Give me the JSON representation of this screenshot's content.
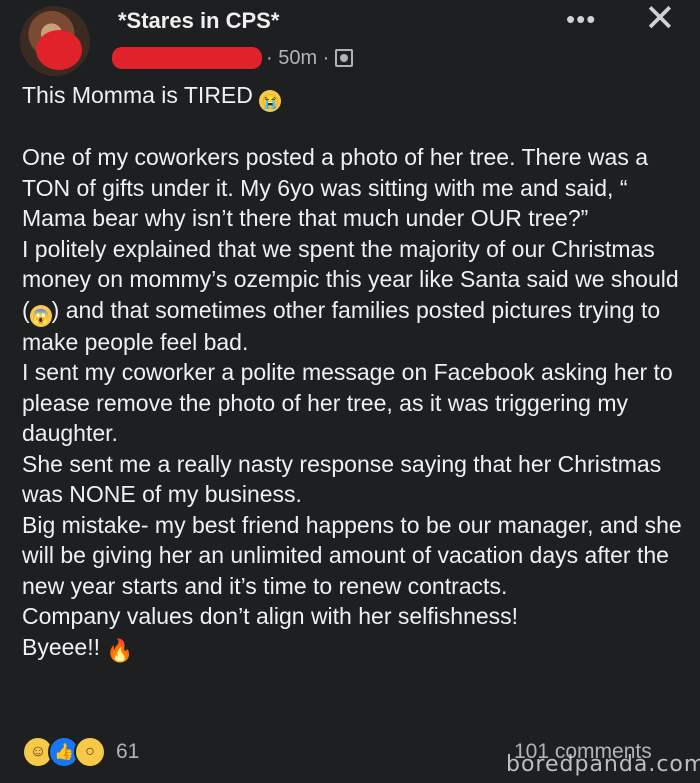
{
  "header": {
    "page_name": "*Stares in CPS*",
    "time": "· 50m ·",
    "more_icon": "more-horizontal-icon",
    "close_icon": "close-icon",
    "privacy_icon": "friends-icon"
  },
  "post": {
    "title": "This Momma is TIRED",
    "paragraphs": [
      "One of my coworkers posted a photo of her tree. There was a TON of gifts under it. My 6yo was sitting with me and said, “ Mama bear why isn’t there that much under OUR tree?”",
      "I politely explained that we spent the majority of our Christmas money on mommy’s ozempic this year like Santa said we should (",
      ") and that sometimes other families posted pictures trying to make people feel bad.",
      "I sent my coworker a polite message on Facebook asking her to please remove the photo of her tree, as it was triggering my daughter.",
      "She sent me a really nasty response saying that her Christmas was NONE of my business.",
      "Big mistake- my best friend happens to be our manager, and she will be giving her an unlimited amount of vacation days after the new year starts and it’s time to renew contracts.",
      "Company values don’t align with her selfishness!",
      "Byeee!!"
    ]
  },
  "footer": {
    "reaction_count": "61",
    "comments": "101 comments",
    "watermark": "boredpanda.com",
    "reactions": [
      "haha-icon",
      "like-icon",
      "wow-icon"
    ]
  }
}
